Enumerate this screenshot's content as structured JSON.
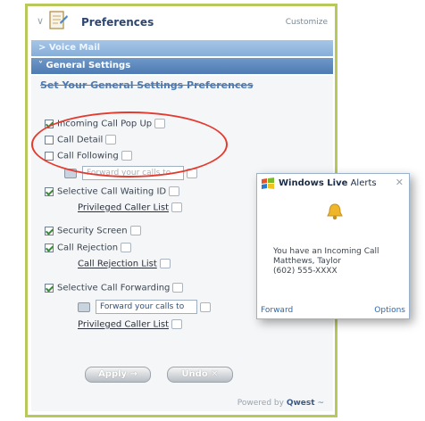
{
  "panel": {
    "title": "Preferences",
    "customize": "Customize",
    "voicemail_bar": "> Voice Mail",
    "general_bar": "˅ General Settings",
    "settings_heading": "Set Your General Settings Preferences"
  },
  "settings": {
    "incoming_popup": {
      "label": "Incoming Call Pop Up",
      "checked": true
    },
    "call_detail": {
      "label": "Call Detail",
      "checked": false
    },
    "call_following": {
      "label": "Call Following",
      "checked": false,
      "input_placeholder": "Forward your calls to"
    },
    "selective_call_waiting": {
      "label": "Selective Call Waiting ID",
      "checked": true,
      "link": "Privileged Caller List"
    },
    "security_screen": {
      "label": "Security Screen",
      "checked": true
    },
    "call_rejection": {
      "label": "Call Rejection",
      "checked": true,
      "link": "Call Rejection List"
    },
    "selective_forwarding": {
      "label": "Selective Call Forwarding",
      "checked": true,
      "input_value": "Forward your calls to",
      "link": "Privileged Caller List"
    }
  },
  "buttons": {
    "apply": "Apply →",
    "undo": "Undo ✕"
  },
  "footer": {
    "powered_prefix": "Powered by",
    "brand": "Qwest"
  },
  "alert": {
    "title_bold": "Windows Live",
    "title_rest": " Alerts",
    "close": "✕",
    "message_line1": "You have an Incoming Call",
    "message_line2": "Matthews, Taylor",
    "message_line3": "(602) 555-XXXX",
    "forward": "Forward",
    "options": "Options"
  },
  "icons": {
    "preferences": "preferences-icon",
    "help": "help-bubble-icon",
    "bell": "bell-icon",
    "phone": "phone-icon",
    "windows_logo": "windows-logo-icon"
  },
  "colors": {
    "accent": "#4e7bb3",
    "panel_border": "#b8c85a",
    "oval": "#e43b30",
    "link": "#2a68b1"
  }
}
